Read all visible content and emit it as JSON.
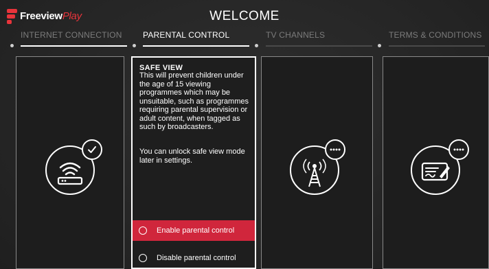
{
  "brand": {
    "logo_word1": "Freeview",
    "logo_word2": "Play",
    "accent_color": "#e8343b",
    "selected_color": "#d0263c"
  },
  "header": {
    "title": "WELCOME"
  },
  "steps": [
    {
      "label": "INTERNET CONNECTION",
      "state": "done"
    },
    {
      "label": "PARENTAL CONTROL",
      "state": "active"
    },
    {
      "label": "TV CHANNELS",
      "state": "pending"
    },
    {
      "label": "TERMS & CONDITIONS",
      "state": "pending"
    }
  ],
  "cards": {
    "internet": {
      "icon": "wifi-router-icon",
      "badge": "check-icon"
    },
    "tv": {
      "icon": "broadcast-tower-icon",
      "badge": "more-icon"
    },
    "terms": {
      "icon": "contract-signature-icon",
      "badge": "more-icon"
    }
  },
  "parental": {
    "heading": "SAFE VIEW",
    "description": "This will prevent children under the age of 15 viewing programmes which may be unsuitable, such as programmes requiring parental supervision or adult content, when tagged as such by broadcasters.",
    "note": "You can unlock safe view mode later in settings.",
    "options": [
      {
        "label": "Enable parental control",
        "selected": true
      },
      {
        "label": "Disable parental control",
        "selected": false
      }
    ]
  }
}
